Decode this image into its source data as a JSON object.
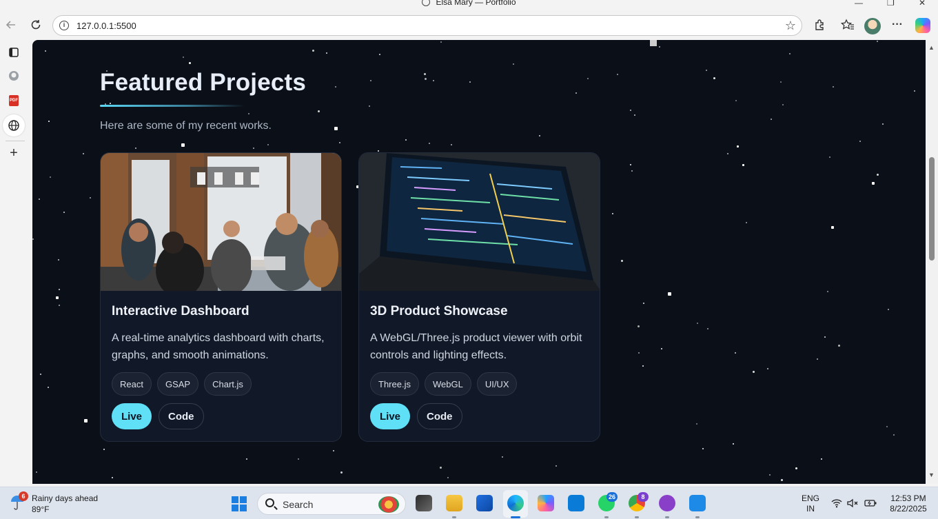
{
  "window": {
    "title": "Elsa Mary — Portfolio",
    "controls": {
      "minimize": "—",
      "maximize": "❐",
      "close": "✕"
    }
  },
  "browser": {
    "url": "127.0.0.1:5500",
    "icons": [
      "back-icon",
      "refresh-icon",
      "info-icon",
      "favorite-star-icon",
      "extensions-icon",
      "favorites-icon",
      "profile-avatar",
      "more-icon",
      "copilot-icon"
    ],
    "more_glyph": "···"
  },
  "sidebar": {
    "items": [
      {
        "name": "tab-actions-icon",
        "glyph": "❐"
      },
      {
        "name": "github-icon",
        "glyph": "◉"
      },
      {
        "name": "pdf-icon",
        "glyph": "PDF"
      },
      {
        "name": "globe-icon",
        "glyph": "🌐",
        "active": true
      },
      {
        "name": "add-icon",
        "glyph": "+"
      }
    ]
  },
  "page": {
    "section_title": "Featured Projects",
    "subtitle": "Here are some of my recent works.",
    "projects": [
      {
        "title": "Interactive Dashboard",
        "description": "A real-time analytics dashboard with charts, graphs, and smooth animations.",
        "tags": [
          "React",
          "GSAP",
          "Chart.js"
        ],
        "live_label": "Live",
        "code_label": "Code",
        "image": "team meeting photo"
      },
      {
        "title": "3D Product Showcase",
        "description": "A WebGL/Three.js product viewer with orbit controls and lighting effects.",
        "tags": [
          "Three.js",
          "WebGL",
          "UI/UX"
        ],
        "live_label": "Live",
        "code_label": "Code",
        "image": "laptop code photo"
      }
    ],
    "colors": {
      "background": "#0b0f17",
      "card": "#111827",
      "accent": "#5fe0f7"
    }
  },
  "taskbar": {
    "weather": {
      "headline": "Rainy days ahead",
      "temp": "89°F",
      "badge": "6"
    },
    "search_placeholder": "Search",
    "apps": [
      {
        "name": "task-view-icon"
      },
      {
        "name": "file-explorer-icon"
      },
      {
        "name": "microsoft-store-icon"
      },
      {
        "name": "edge-icon",
        "active": true
      },
      {
        "name": "copilot-app-icon"
      },
      {
        "name": "cortana-icon"
      },
      {
        "name": "whatsapp-icon",
        "badge": "26"
      },
      {
        "name": "chrome-icon",
        "badge": "8"
      },
      {
        "name": "github-desktop-icon"
      },
      {
        "name": "vscode-icon"
      }
    ],
    "language": {
      "lang": "ENG",
      "region": "IN"
    },
    "time": "12:53 PM",
    "date": "8/22/2025"
  }
}
